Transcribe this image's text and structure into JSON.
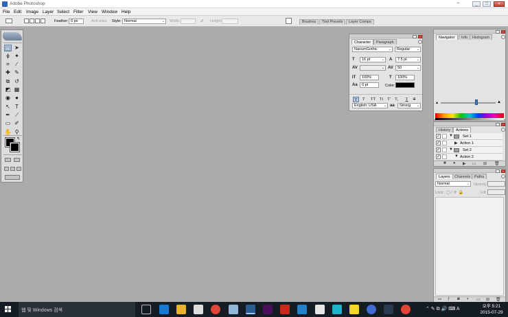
{
  "window": {
    "title": "Adobe Photoshop",
    "controls": [
      "_",
      "□",
      "×"
    ]
  },
  "menu": [
    "File",
    "Edit",
    "Image",
    "Layer",
    "Select",
    "Filter",
    "View",
    "Window",
    "Help"
  ],
  "options_bar": {
    "feather_label": "Feather:",
    "feather_value": "0 px",
    "antialias_label": "Anti-alias",
    "style_label": "Style:",
    "style_value": "Normal",
    "width_label": "Width:",
    "height_label": "Height:",
    "well_tabs": [
      "Brushes",
      "Tool Presets",
      "Layer Comps"
    ]
  },
  "tools": [
    {
      "glyph": "⬚",
      "name": "marquee"
    },
    {
      "glyph": "➤",
      "name": "move"
    },
    {
      "glyph": "ϕ",
      "name": "lasso"
    },
    {
      "glyph": "✦",
      "name": "magic-wand"
    },
    {
      "glyph": "⌗",
      "name": "crop"
    },
    {
      "glyph": "∕",
      "name": "slice"
    },
    {
      "glyph": "✚",
      "name": "healing"
    },
    {
      "glyph": "✎",
      "name": "brush"
    },
    {
      "glyph": "⧉",
      "name": "stamp"
    },
    {
      "glyph": "↺",
      "name": "history-brush"
    },
    {
      "glyph": "◩",
      "name": "eraser"
    },
    {
      "glyph": "▦",
      "name": "gradient"
    },
    {
      "glyph": "◉",
      "name": "blur"
    },
    {
      "glyph": "●",
      "name": "dodge"
    },
    {
      "glyph": "↖",
      "name": "path-select"
    },
    {
      "glyph": "T",
      "name": "type"
    },
    {
      "glyph": "✒",
      "name": "pen"
    },
    {
      "glyph": "⟋",
      "name": "line"
    },
    {
      "glyph": "▭",
      "name": "notes"
    },
    {
      "glyph": "✐",
      "name": "eyedropper"
    },
    {
      "glyph": "✋",
      "name": "hand"
    },
    {
      "glyph": "⚲",
      "name": "zoom"
    }
  ],
  "character_panel": {
    "tabs": [
      "Character",
      "Paragraph"
    ],
    "font_family": "NanumGothic",
    "font_style": "Regular",
    "font_size": "16 pt",
    "leading": "7.5 pt",
    "kerning": "",
    "tracking": "50",
    "vertical_scale": "100%",
    "horizontal_scale": "100%",
    "baseline_shift": "0 pt",
    "color_label": "Color:",
    "language": "English: USA",
    "antialias": "Strong",
    "style_buttons": [
      "T",
      "T",
      "TT",
      "Tt",
      "T'",
      "T,",
      "T",
      "T"
    ]
  },
  "navigator_panel": {
    "tabs": [
      "Navigator",
      "Info",
      "Histogram"
    ],
    "zoom_level": 0.65
  },
  "actions_panel": {
    "tabs": [
      "History",
      "Actions"
    ],
    "rows": [
      {
        "label": "Set 1",
        "expanded": true,
        "type": "set"
      },
      {
        "label": "Action 1",
        "expanded": false,
        "type": "action"
      },
      {
        "label": "Set 2",
        "expanded": true,
        "type": "set"
      },
      {
        "label": "Action 2",
        "expanded": true,
        "type": "action"
      }
    ]
  },
  "layers_panel": {
    "tabs": [
      "Layers",
      "Channels",
      "Paths"
    ],
    "blend_mode": "Normal",
    "opacity_label": "Opacity:",
    "lock_label": "Lock:",
    "fill_label": "Fill:"
  },
  "taskbar": {
    "search_placeholder": "웹 및 Windows 검색",
    "tray_lang": "A",
    "time": "오후 5:21",
    "date": "2015-07-29"
  },
  "colors": {
    "canvas": "#ababab",
    "foreground": "#000000",
    "background": "#000000",
    "taskbar": "#151c24"
  }
}
